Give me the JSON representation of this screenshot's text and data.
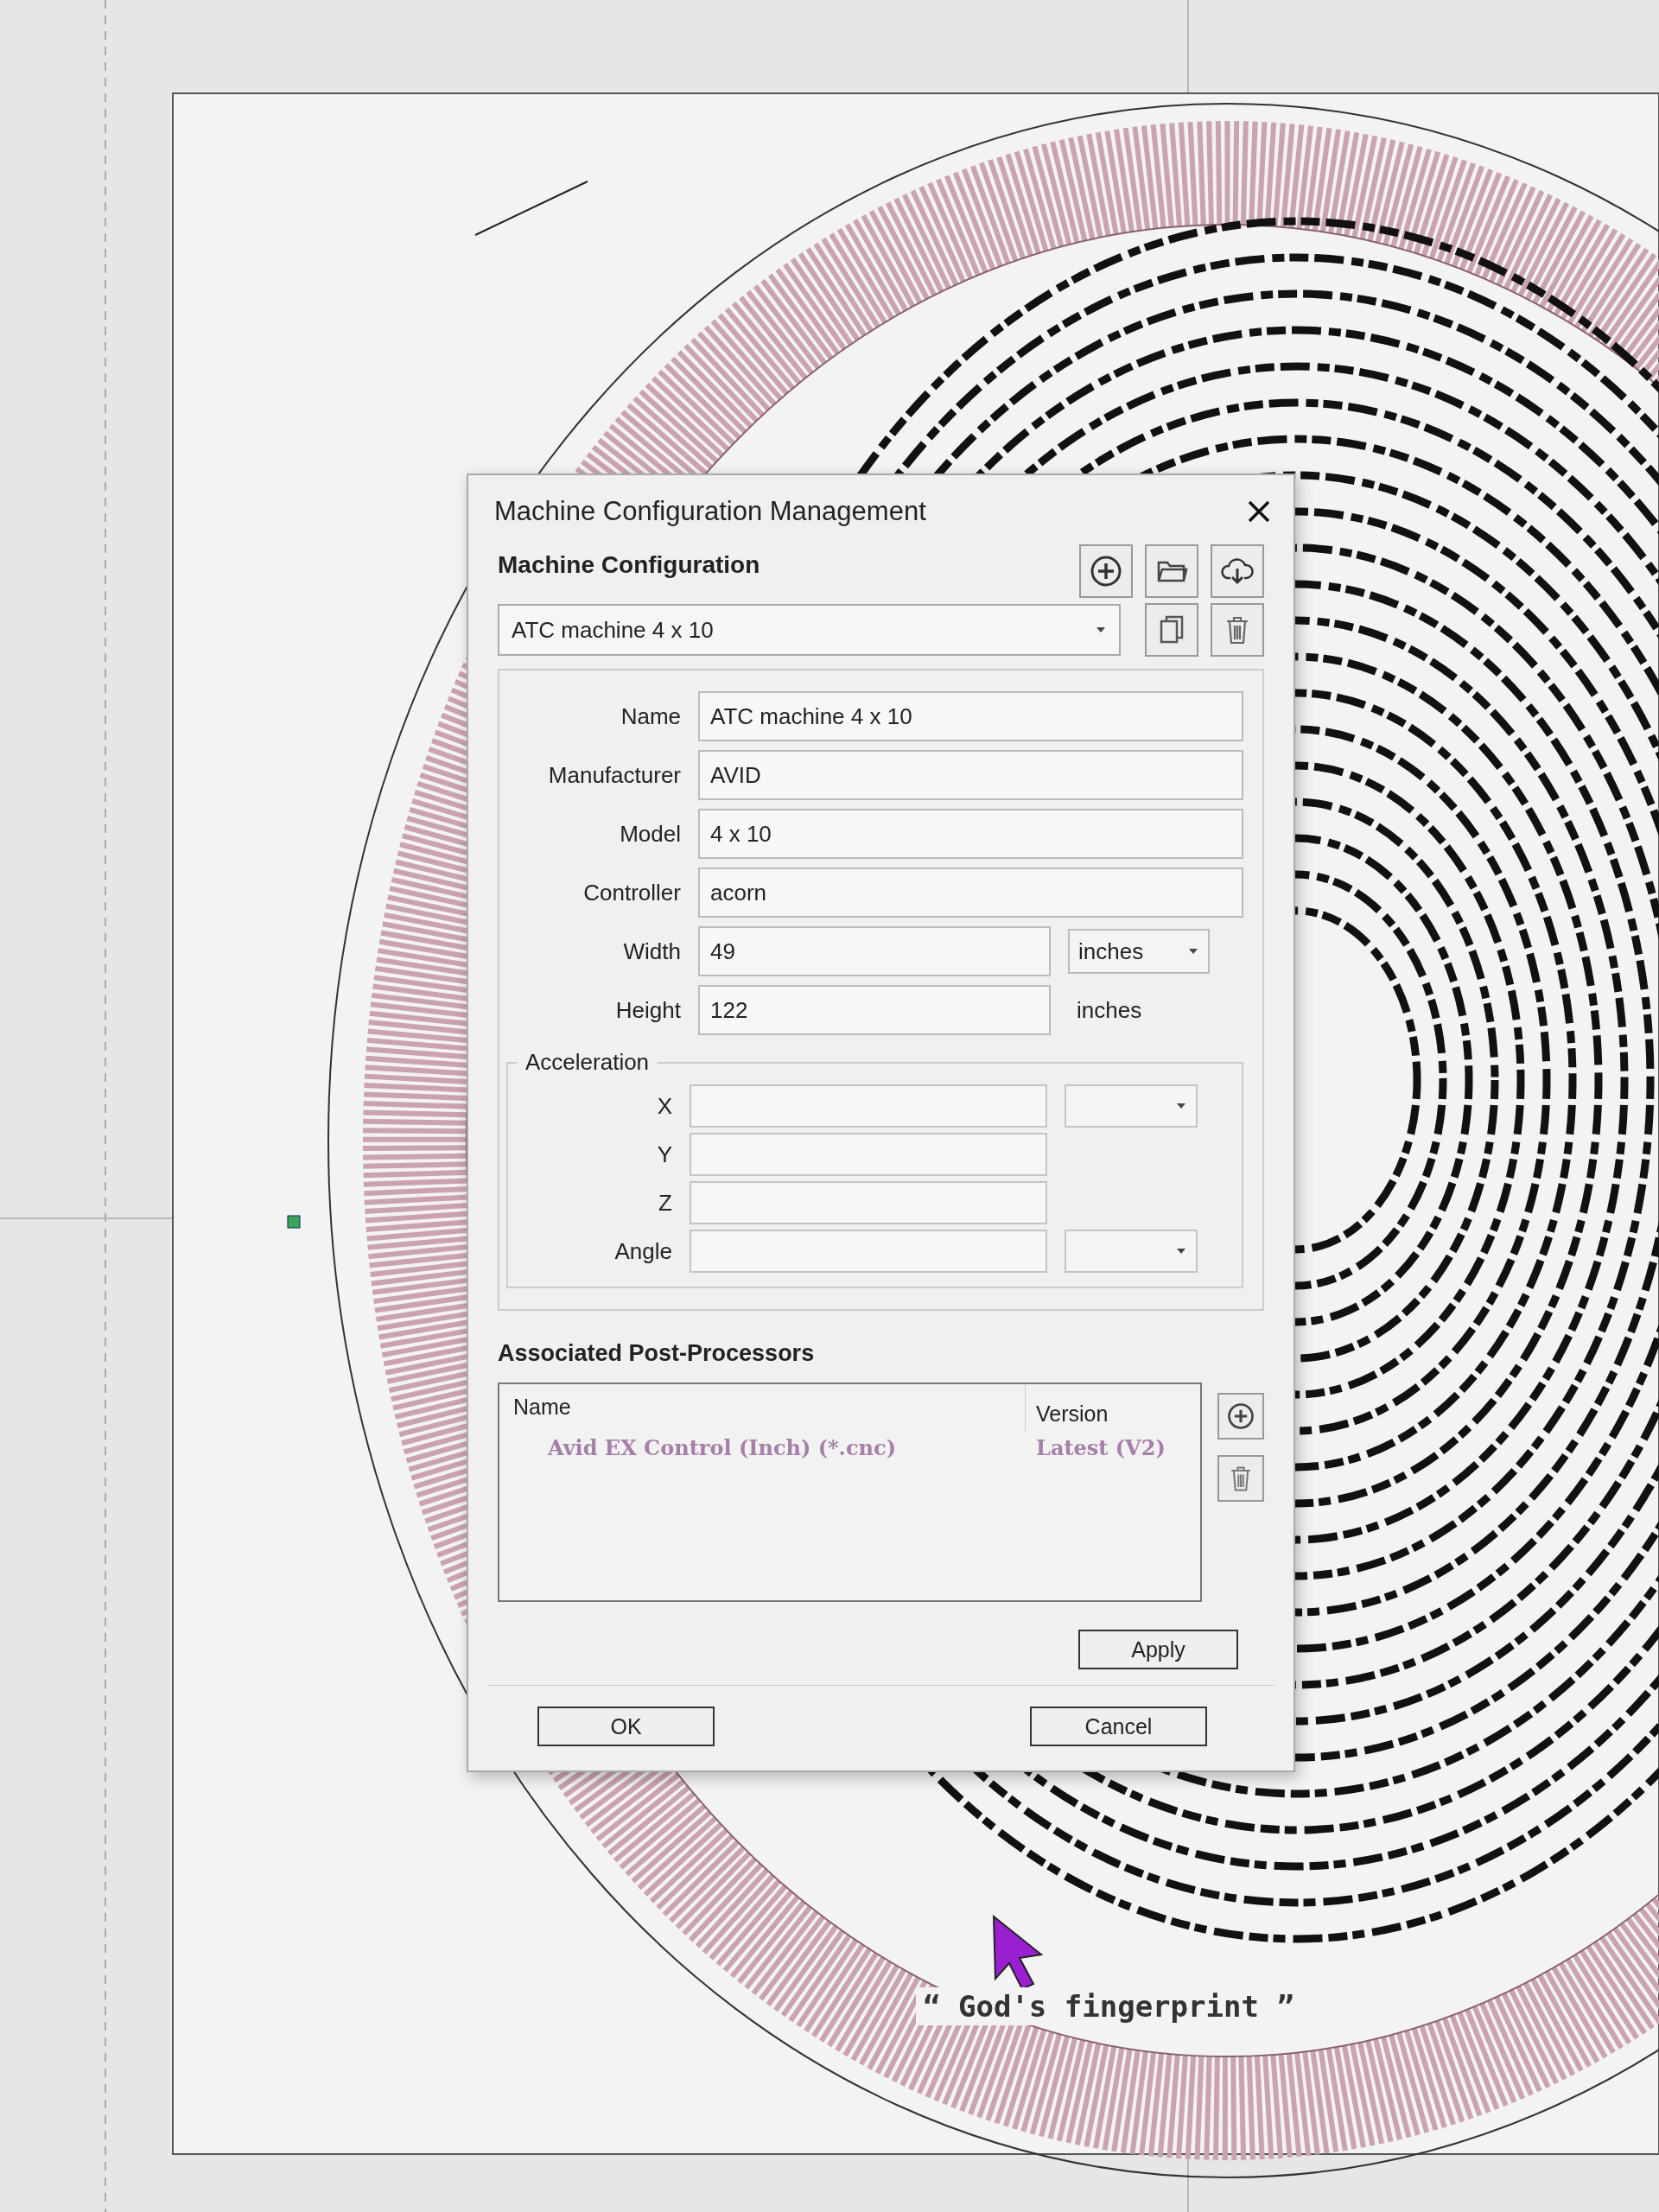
{
  "window": {
    "title": "Machine Configuration Management"
  },
  "machine_configuration": {
    "heading": "Machine Configuration",
    "selected": "ATC machine 4 x 10"
  },
  "fields": [
    {
      "label": "Name",
      "value": "ATC machine 4 x 10"
    },
    {
      "label": "Manufacturer",
      "value": "AVID"
    },
    {
      "label": "Model",
      "value": "4 x 10"
    },
    {
      "label": "Controller",
      "value": "acorn"
    },
    {
      "label": "Width",
      "value": "49",
      "unit": "inches",
      "unit_dropdown": true
    },
    {
      "label": "Height",
      "value": "122",
      "unit": "inches",
      "unit_dropdown": false
    }
  ],
  "acceleration": {
    "title": "Acceleration",
    "axes": [
      {
        "label": "X",
        "unit_dropdown": true
      },
      {
        "label": "Y",
        "unit_dropdown": false
      },
      {
        "label": "Z",
        "unit_dropdown": false
      },
      {
        "label": "Angle",
        "unit_dropdown": true
      }
    ]
  },
  "post_processors": {
    "heading": "Associated Post-Processors",
    "columns": [
      "Name",
      "Version"
    ],
    "rows": [
      {
        "name": "Avid EX Control (Inch) (*.cnc)",
        "version": "Latest (V2)"
      }
    ]
  },
  "buttons": {
    "apply": "Apply",
    "ok": "OK",
    "cancel": "Cancel"
  },
  "canvas": {
    "caption": "“ God's fingerprint ”"
  }
}
